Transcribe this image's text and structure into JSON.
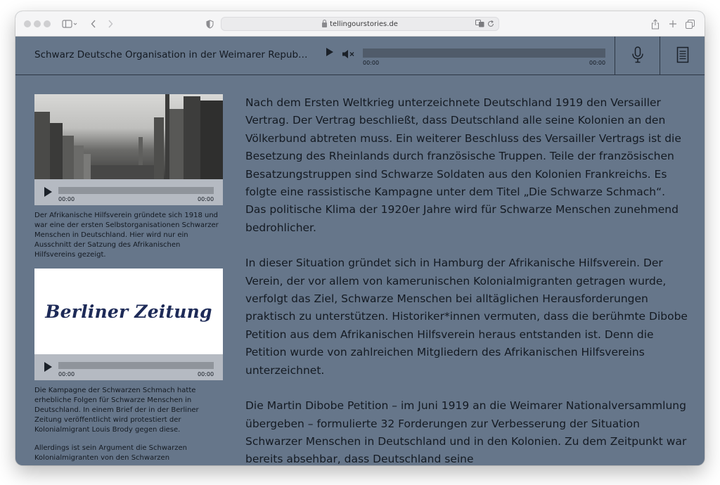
{
  "browser": {
    "url": "tellingourstories.de"
  },
  "player": {
    "title": "Schwarz Deutsche Organisation in der Weimarer Repub…",
    "time_current": "00:00",
    "time_total": "00:00",
    "mic_icon": "microphone-icon",
    "transcript_icon": "document-icon"
  },
  "sidebar": {
    "media": [
      {
        "type": "photo",
        "time_current": "00:00",
        "time_total": "00:00",
        "caption": "Der Afrikanische Hilfsverein gründete sich 1918 und war eine der ersten Selbstorganisationen Schwarzer Menschen in Deutschland. Hier wird nur ein Ausschnitt der Satzung des Afrikanischen Hilfsvereins gezeigt."
      },
      {
        "type": "logo",
        "logo_text": "Berliner Zeitung",
        "time_current": "00:00",
        "time_total": "00:00",
        "caption": "Die Kampagne der Schwarzen Schmach hatte erhebliche Folgen für Schwarze Menschen in Deutschland. In einem Brief der in der Berliner Zeitung veröffentlicht wird protestiert der Kolonialmigrant Louis Brody gegen diese.",
        "caption_2": "Allerdings ist sein Argument die Schwarzen Kolonialmigranten von den Schwarzen"
      }
    ]
  },
  "article": {
    "paragraphs": [
      "Nach dem Ersten Weltkrieg unterzeichnete Deutschland 1919 den Versailler Vertrag. Der Vertrag beschließt, dass Deutschland alle seine Kolonien an den Völkerbund abtreten muss. Ein weiterer Beschluss des Versailler Vertrags ist die Besetzung des Rheinlands durch französische Truppen. Teile der französischen Besatzungstruppen sind Schwarze Soldaten aus den Kolonien Frankreichs. Es folgte eine rassistische Kampagne unter dem Titel „Die Schwarze Schmach“. Das politische Klima der 1920er Jahre wird für Schwarze Menschen zunehmend bedrohlicher.",
      "In dieser Situation gründet sich in Hamburg der Afrikanische Hilfsverein. Der Verein, der vor allem von kamerunischen Kolonialmigranten getragen wurde, verfolgt das Ziel, Schwarze Menschen bei alltäglichen Herausforderungen praktisch zu unterstützen. Historiker*innen vermuten, dass die berühmte Dibobe Petition aus dem Afrikanischen Hilfsverein heraus entstanden ist. Denn die Petition wurde von zahlreichen Mitgliedern des Afrikanischen Hilfsvereins unterzeichnet.",
      "Die Martin Dibobe Petition – im Juni 1919 an die Weimarer Nationalversammlung übergeben – formulierte 32 Forderungen zur Verbesserung der Situation Schwarzer Menschen in Deutschland und in den Kolonien. Zu dem Zeitpunkt war bereits absehbar, dass Deutschland seine"
    ]
  }
}
